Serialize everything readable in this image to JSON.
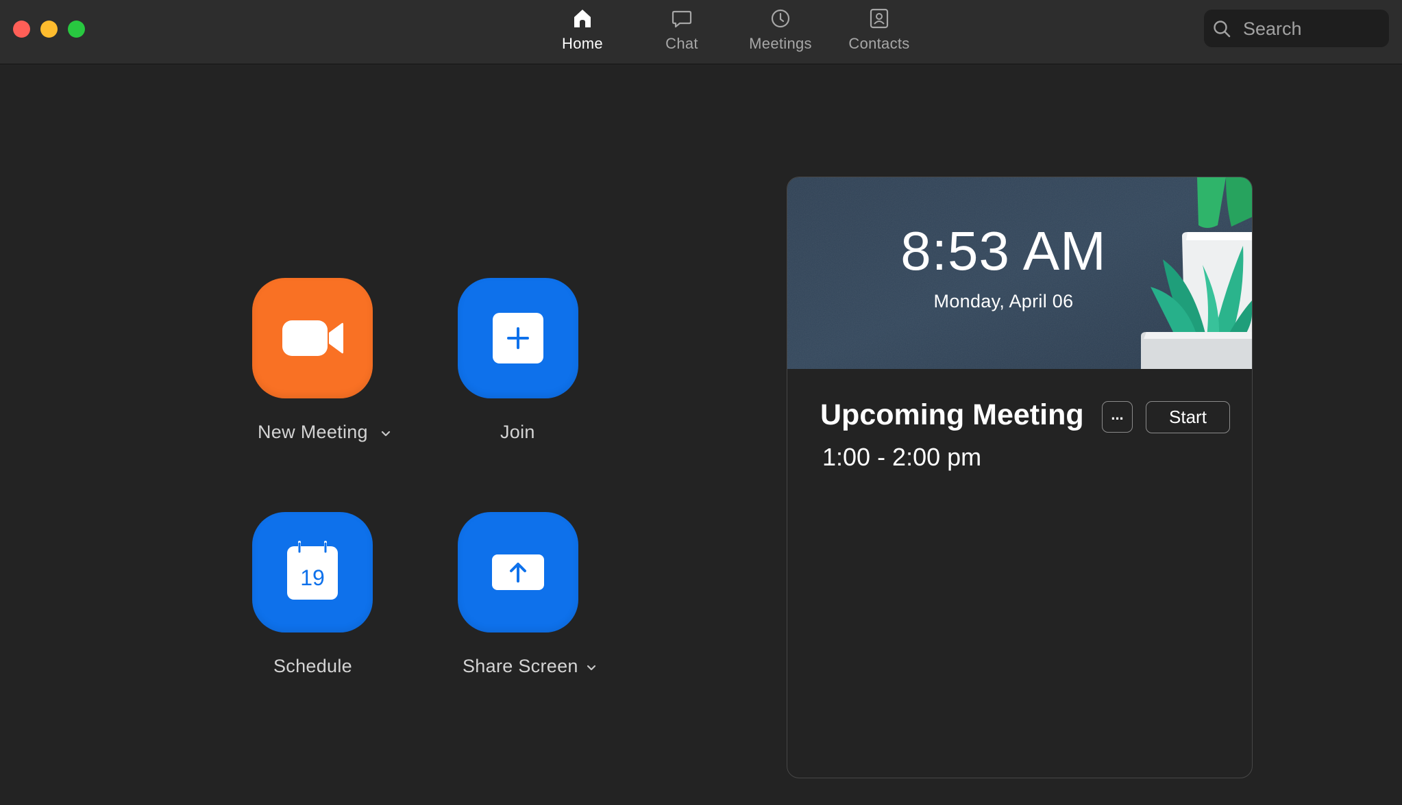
{
  "window": {
    "traffic_lights": [
      {
        "name": "close",
        "color": "#ff5f57"
      },
      {
        "name": "minimize",
        "color": "#febc2e"
      },
      {
        "name": "zoom",
        "color": "#28c840"
      }
    ]
  },
  "nav": {
    "active": "Home",
    "tabs": [
      {
        "label": "Home",
        "icon": "home-icon"
      },
      {
        "label": "Chat",
        "icon": "chat-bubble-icon"
      },
      {
        "label": "Meetings",
        "icon": "clock-icon"
      },
      {
        "label": "Contacts",
        "icon": "contact-card-icon"
      }
    ]
  },
  "search": {
    "placeholder": "Search",
    "value": "",
    "icon": "search-icon"
  },
  "actions": [
    {
      "label": "New Meeting",
      "icon": "video-camera-icon",
      "color": "#f97124",
      "has_dropdown": true
    },
    {
      "label": "Join",
      "icon": "plus-icon",
      "color": "#0e71eb",
      "has_dropdown": false
    },
    {
      "label": "Schedule",
      "icon": "calendar-icon",
      "icon_text": "19",
      "color": "#0e71eb",
      "has_dropdown": false
    },
    {
      "label": "Share Screen",
      "icon": "upload-arrow-icon",
      "color": "#0e71eb",
      "has_dropdown": true
    }
  ],
  "clock": {
    "time": "8:53 AM",
    "date": "Monday, April 06"
  },
  "upcoming": {
    "heading": "Upcoming Meeting",
    "time_range": "1:00 - 2:00 pm",
    "more_label": "...",
    "start_label": "Start"
  },
  "colors": {
    "background": "#232323",
    "titlebar": "#2d2d2d",
    "accent_blue": "#0e71eb",
    "accent_orange": "#f97124"
  }
}
